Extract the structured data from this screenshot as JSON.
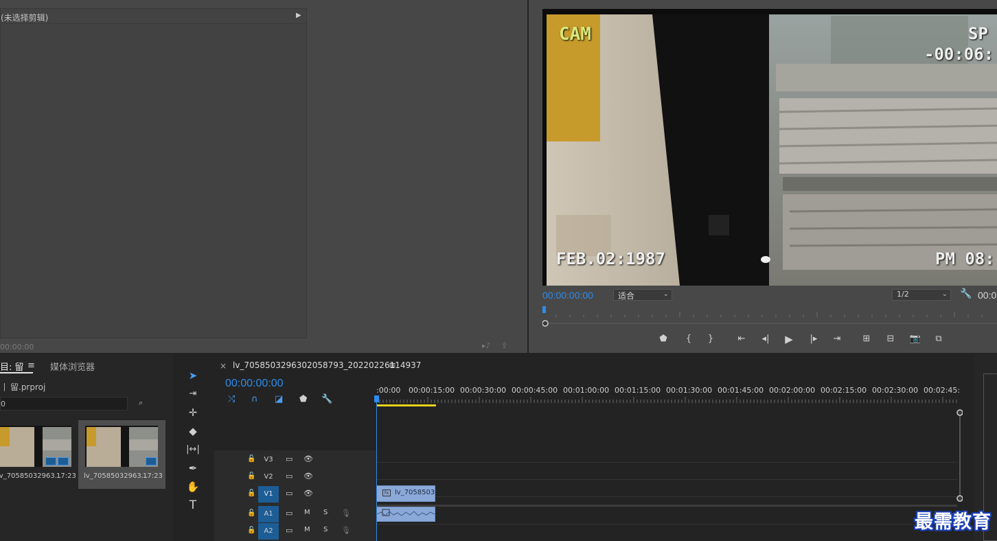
{
  "source": {
    "header_label": "(未选择剪辑)",
    "timecode": "00:00:00"
  },
  "program": {
    "osd": {
      "cam": "CAM",
      "sp": "SP",
      "counter": "-00:06:",
      "date": "FEB.02:1987",
      "time": "PM 08:"
    },
    "timecode": "00:00:00:00",
    "fit_value": "适合",
    "resolution_value": "1/2",
    "timecode_right": "00:0"
  },
  "project": {
    "tab_project": "目: 留",
    "tab_media_browser": "媒体浏览器",
    "project_file": "留.prproj",
    "search_value": "0",
    "items": [
      {
        "name": "lv_70585032963...",
        "duration": "17:23"
      },
      {
        "name": "lv_70585032963...",
        "duration": "17:23"
      }
    ]
  },
  "timeline": {
    "sequence_name": "lv_7058503296302058793_20220226114937",
    "timecode": "00:00:00:00",
    "ruler_labels": [
      ":00:00",
      "00:00:15:00",
      "00:00:30:00",
      "00:00:45:00",
      "00:01:00:00",
      "00:01:15:00",
      "00:01:30:00",
      "00:01:45:00",
      "00:02:00:00",
      "00:02:15:00",
      "00:02:30:00",
      "00:02:45:"
    ],
    "tracks": {
      "v3": "V3",
      "v2": "V2",
      "v1": "V1",
      "a1": "A1",
      "a2": "A2",
      "mute": "M",
      "solo": "S"
    },
    "clip_v1_name": "lv_70585032"
  },
  "watermark": "最需教育",
  "colors": {
    "accent_blue": "#2d8ceb",
    "work_area": "#e6d21b",
    "clip_video": "#8aa9d9",
    "track_target": "#1c5d96"
  },
  "icons": [
    "play-icon",
    "step-back-icon",
    "step-forward-icon",
    "go-to-in-icon",
    "go-to-out-icon",
    "mark-in-icon",
    "mark-out-icon",
    "add-marker-icon",
    "lift-icon",
    "extract-icon",
    "export-frame-icon",
    "compare-icon",
    "wrench-icon",
    "selection-tool-icon",
    "track-select-tool-icon",
    "ripple-edit-tool-icon",
    "razor-tool-icon",
    "slip-tool-icon",
    "pen-tool-icon",
    "hand-tool-icon",
    "type-tool-icon",
    "lock-icon",
    "eye-icon",
    "film-icon",
    "mic-icon"
  ]
}
